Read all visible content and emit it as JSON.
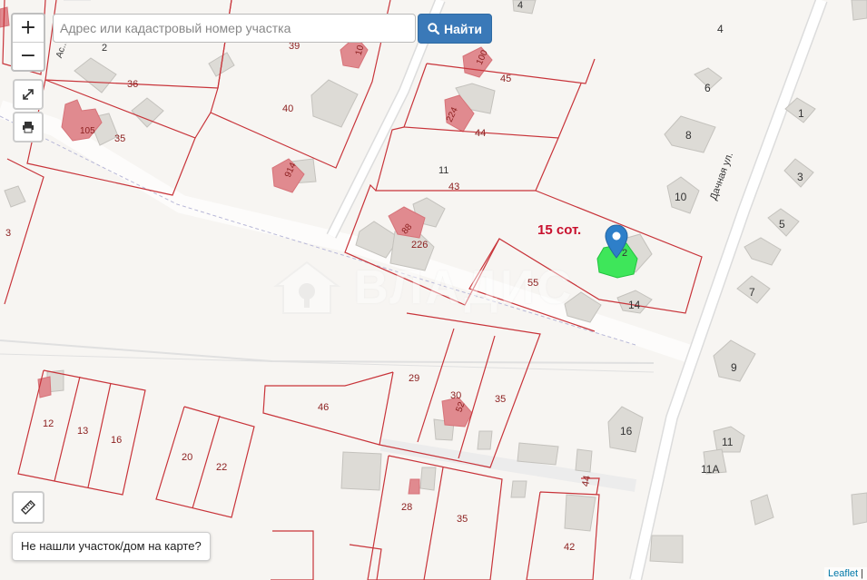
{
  "search": {
    "placeholder": "Адрес или кадастровый номер участка",
    "button_label": "Найти"
  },
  "controls": {
    "zoom_in": "+",
    "zoom_out": "−",
    "fullscreen_icon": "expand-icon",
    "print_icon": "printer-icon",
    "ruler_icon": "ruler-icon"
  },
  "not_found_label": "Не нашли участок/дом на карте?",
  "attribution": {
    "link": "Leaflet",
    "separator": "|"
  },
  "watermark": "ВЛАДИС",
  "area_label": "15 сот.",
  "street_label": "Дачная ул.",
  "partial_street_label": "Ас...ов.",
  "colors": {
    "parcel_border": "#c8343a",
    "selected_building": "#3ee65a",
    "registered_building": "#e08a8f",
    "plain_building": "#dddbd6",
    "marker": "#2e7fc9",
    "button": "#3a79b8",
    "number_text": "#8b1e1e",
    "house_number": "#333333",
    "area_label": "#c8102e"
  },
  "parcel_numbers": [
    "36",
    "35",
    "39",
    "40",
    "45",
    "44",
    "43",
    "11",
    "55",
    "226",
    "29",
    "30",
    "35",
    "46",
    "12",
    "13",
    "16",
    "20",
    "22",
    "28",
    "35",
    "42",
    "3",
    "2",
    "4",
    "44"
  ],
  "building_numbers": [
    "105",
    "100",
    "224",
    "914",
    "88",
    "10",
    "52"
  ],
  "house_numbers": [
    "4",
    "6",
    "1",
    "8",
    "3",
    "10",
    "5",
    "7",
    "9",
    "14",
    "16",
    "11",
    "11А",
    "2"
  ]
}
